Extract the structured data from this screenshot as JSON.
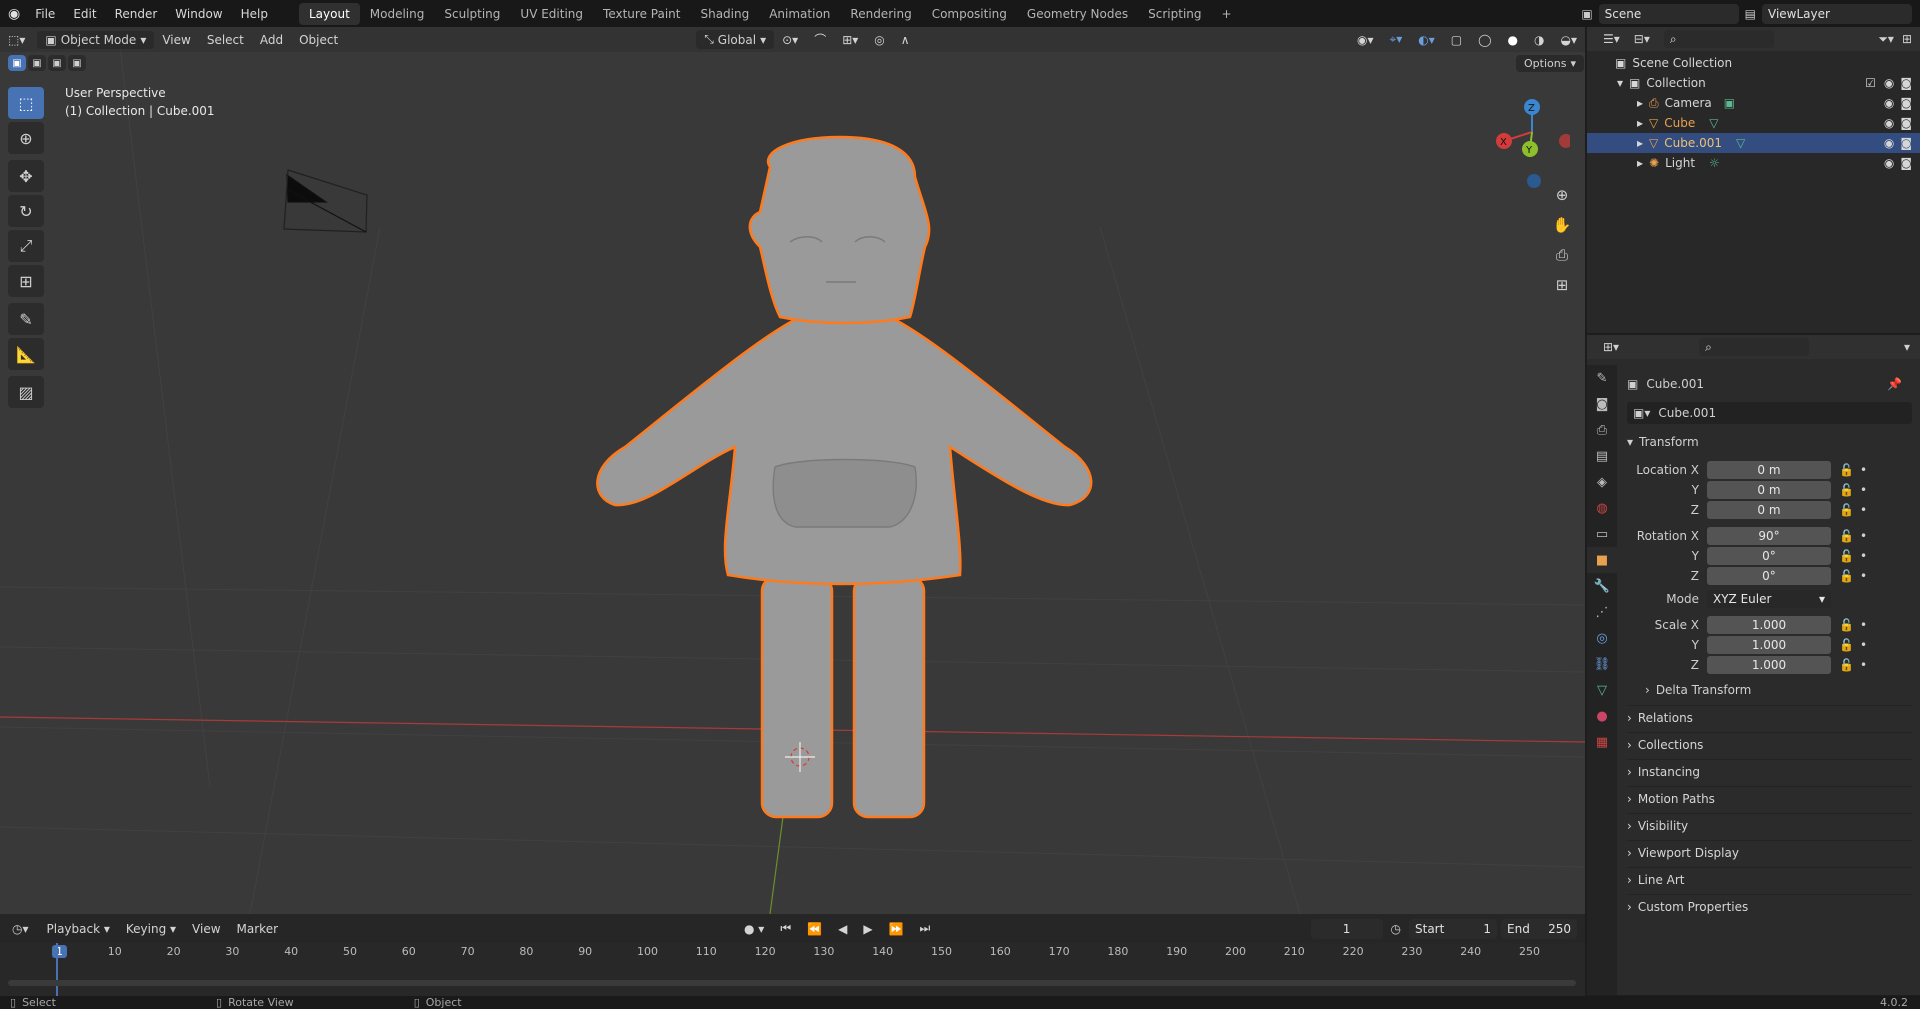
{
  "topbar": {
    "menus": [
      "File",
      "Edit",
      "Render",
      "Window",
      "Help"
    ],
    "workspaces": [
      "Layout",
      "Modeling",
      "Sculpting",
      "UV Editing",
      "Texture Paint",
      "Shading",
      "Animation",
      "Rendering",
      "Compositing",
      "Geometry Nodes",
      "Scripting"
    ],
    "active_workspace": "Layout",
    "add_tab": "+",
    "scene": "Scene",
    "view_layer": "ViewLayer"
  },
  "viewport": {
    "mode": "Object Mode",
    "menus": [
      "View",
      "Select",
      "Add",
      "Object"
    ],
    "orientation": "Global",
    "options": "Options",
    "overlay_title": "User Perspective",
    "overlay_subtitle": "(1) Collection | Cube.001",
    "gizmo": {
      "x": "X",
      "y": "Y",
      "z": "Z"
    }
  },
  "outliner": {
    "root": "Scene Collection",
    "collection": "Collection",
    "items": [
      {
        "name": "Camera",
        "selected": false,
        "color": "#d6d6d6"
      },
      {
        "name": "Cube",
        "selected": false,
        "color": "#e8a14f"
      },
      {
        "name": "Cube.001",
        "selected": true,
        "color": "#f0c070"
      },
      {
        "name": "Light",
        "selected": false,
        "color": "#d6d6d6"
      }
    ]
  },
  "properties": {
    "object_name": "Cube.001",
    "data_name": "Cube.001",
    "transform_label": "Transform",
    "location": {
      "label": "Location X",
      "x": "0 m",
      "y": "0 m",
      "z": "0 m"
    },
    "rotation": {
      "label": "Rotation X",
      "x": "90°",
      "y": "0°",
      "z": "0°"
    },
    "mode_label": "Mode",
    "mode_value": "XYZ Euler",
    "scale": {
      "label": "Scale X",
      "x": "1.000",
      "y": "1.000",
      "z": "1.000"
    },
    "axis_y": "Y",
    "axis_z": "Z",
    "delta_transform": "Delta Transform",
    "panels": [
      "Relations",
      "Collections",
      "Instancing",
      "Motion Paths",
      "Visibility",
      "Viewport Display",
      "Line Art",
      "Custom Properties"
    ]
  },
  "timeline": {
    "menus": [
      "Playback",
      "Keying",
      "View",
      "Marker"
    ],
    "current_frame": "1",
    "start_label": "Start",
    "start_value": "1",
    "end_label": "End",
    "end_value": "250",
    "ruler_ticks": [
      "1",
      "10",
      "20",
      "30",
      "40",
      "50",
      "60",
      "70",
      "80",
      "90",
      "100",
      "110",
      "120",
      "130",
      "140",
      "150",
      "160",
      "170",
      "180",
      "190",
      "200",
      "210",
      "220",
      "230",
      "240",
      "250"
    ]
  },
  "statusbar": {
    "select": "Select",
    "rotate": "Rotate View",
    "object": "Object",
    "version": "4.0.2"
  },
  "colors": {
    "selection_outline": "#ff7a1c",
    "active_tool": "#4772b3",
    "outliner_selected": "#334d80",
    "x_axis": "#d63b3b",
    "y_axis": "#8dbf2c",
    "z_axis": "#3a86d1"
  }
}
